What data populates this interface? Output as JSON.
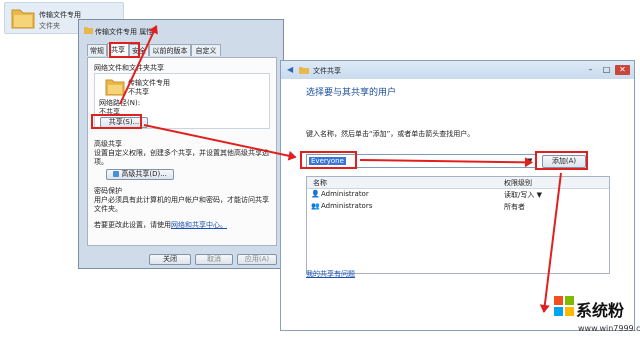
{
  "desktop_folder": {
    "name": "传输文件专用",
    "type": "文件夹"
  },
  "properties_dialog": {
    "title": "传输文件专用 属性",
    "tabs": [
      "常规",
      "共享",
      "安全",
      "以前的版本",
      "自定义"
    ],
    "network_section_title": "网络文件和文件夹共享",
    "folder_name": "传输文件专用",
    "folder_state": "不共享",
    "network_path_label": "网络路径(N):",
    "network_path_value": "不共享",
    "share_button": "共享(S)...",
    "advanced_title": "高级共享",
    "advanced_desc": "设置自定义权限，创建多个共享，并设置其他高级共享选项。",
    "advanced_button": "高级共享(D)...",
    "password_title": "密码保护",
    "password_desc": "用户必须具有此计算机的用户帐户和密码，才能访问共享文件夹。",
    "change_setting_prefix": "若要更改此设置，请使用",
    "network_center_link": "网络和共享中心。",
    "buttons": [
      "关闭",
      "取消",
      "应用(A)"
    ]
  },
  "share_dialog": {
    "title": "文件共享",
    "heading": "选择要与其共享的用户",
    "instruction": "键入名称，然后单击“添加”，或者单击箭头查找用户。",
    "input_value": "Everyone",
    "add_button": "添加(A)",
    "col_name": "名称",
    "col_permission": "权限级别",
    "rows": [
      {
        "name": "Administrator",
        "permission": "读取/写入 ▼"
      },
      {
        "name": "Administrators",
        "permission": "所有者"
      }
    ],
    "problem_link": "我的共享有问题"
  },
  "logo": {
    "text": "系统粉",
    "url": "www.win7999.com"
  },
  "colors": {
    "annotation": "#e0201f",
    "link": "#1d4fb3"
  }
}
